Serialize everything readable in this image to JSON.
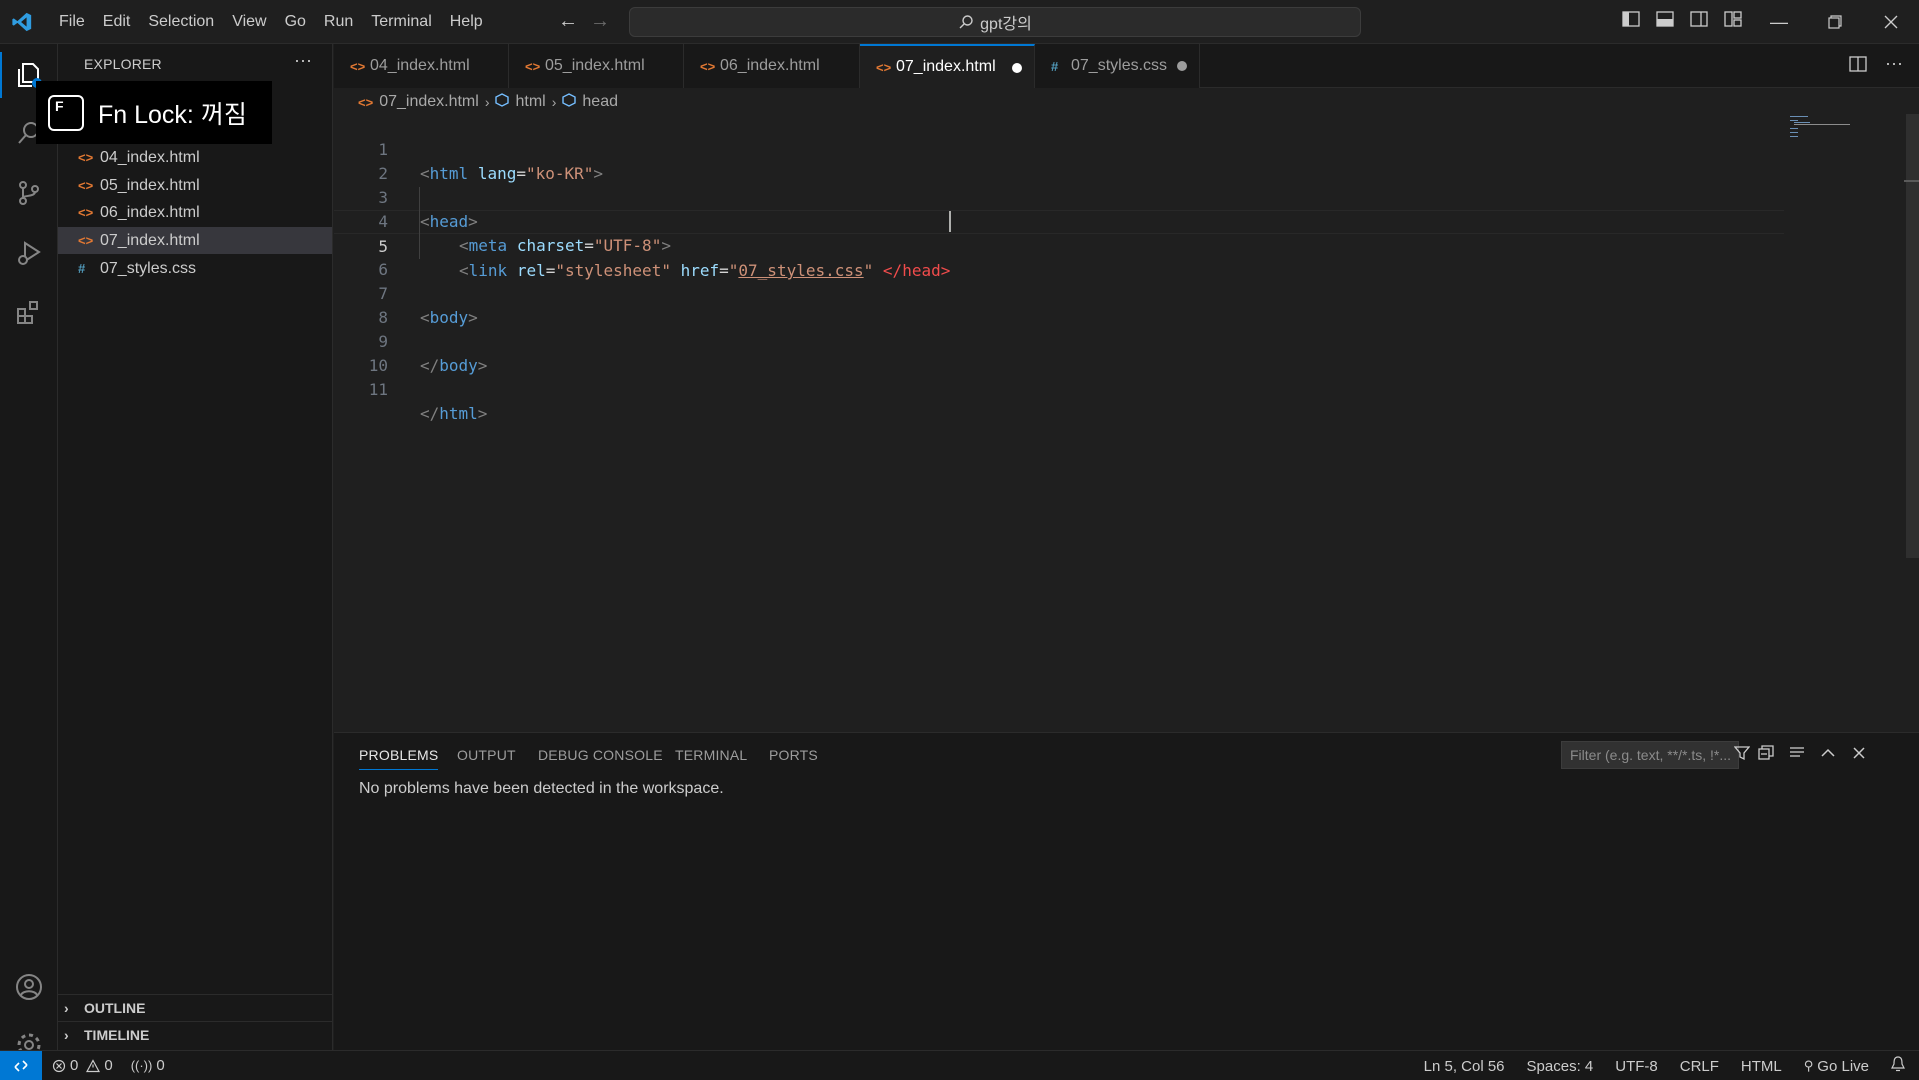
{
  "menubar": {
    "items": [
      "File",
      "Edit",
      "Selection",
      "View",
      "Go",
      "Run",
      "Terminal",
      "Help"
    ],
    "search_text": "gpt강의"
  },
  "activitybar": {
    "items": [
      "explorer-icon",
      "search-icon",
      "source-control-icon",
      "run-debug-icon",
      "extensions-icon"
    ],
    "bottom": [
      "accounts-icon",
      "manage-gear-icon"
    ]
  },
  "sidebar": {
    "title": "EXPLORER",
    "files": [
      {
        "name": "04_index.html",
        "icon": "<>"
      },
      {
        "name": "05_index.html",
        "icon": "<>"
      },
      {
        "name": "06_index.html",
        "icon": "<>"
      },
      {
        "name": "07_index.html",
        "icon": "<>"
      },
      {
        "name": "07_styles.css",
        "icon": "#"
      }
    ],
    "selected_file": "07_index.html",
    "outline": "OUTLINE",
    "timeline": "TIMELINE"
  },
  "tooltip": {
    "key_letter": "F",
    "text": "Fn  Lock: 꺼짐"
  },
  "tabs": [
    {
      "label": "04_index.html",
      "icon": "<>"
    },
    {
      "label": "05_index.html",
      "icon": "<>"
    },
    {
      "label": "06_index.html",
      "icon": "<>"
    },
    {
      "label": "07_index.html",
      "icon": "<>"
    },
    {
      "label": "07_styles.css",
      "icon": "#"
    }
  ],
  "breadcrumbs": {
    "file": "07_index.html",
    "node1": "html",
    "node2": "head"
  },
  "editor": {
    "line_numbers": [
      "1",
      "2",
      "3",
      "4",
      "5",
      "6",
      "7",
      "8",
      "9",
      "10",
      "11"
    ],
    "code": {
      "l1_open": "<",
      "l1_tag": "html",
      "l1_attr": "lang",
      "l1_eq": "=",
      "l1_val": "\"ko-KR\"",
      "l1_close": ">",
      "l3_open": "<",
      "l3_tag": "head",
      "l3_close": ">",
      "l4_open": "<",
      "l4_tag": "meta",
      "l4_attr": "charset",
      "l4_eq": "=",
      "l4_val": "\"UTF-8\"",
      "l4_close": ">",
      "l5_open": "<",
      "l5_tag": "link",
      "l5_attr1": "rel",
      "l5_eq1": "=",
      "l5_val1": "\"stylesheet\"",
      "l5_attr2": "href",
      "l5_eq2": "=",
      "l5_q1": "\"",
      "l5_href": "07_styles.css",
      "l5_q2": "\"",
      "l5_endhead": "</head>",
      "l7_open": "<",
      "l7_tag": "body",
      "l7_close": ">",
      "l9_open": "</",
      "l9_tag": "body",
      "l9_close": ">",
      "l11_open": "</",
      "l11_tag": "html",
      "l11_close": ">"
    }
  },
  "panel": {
    "tabs": [
      "PROBLEMS",
      "OUTPUT",
      "DEBUG CONSOLE",
      "TERMINAL",
      "PORTS"
    ],
    "filter_placeholder": "Filter (e.g. text, **/*.ts, !*...",
    "message": "No problems have been detected in the workspace."
  },
  "statusbar": {
    "errors": "0",
    "warnings": "0",
    "ports": "0",
    "position": "Ln 5, Col 56",
    "spaces": "Spaces: 4",
    "encoding": "UTF-8",
    "eol": "CRLF",
    "language": "HTML",
    "golive": "Go Live"
  },
  "colors": {
    "accent": "#0078d4",
    "html_icon": "#e37933",
    "css_icon": "#519aba"
  }
}
